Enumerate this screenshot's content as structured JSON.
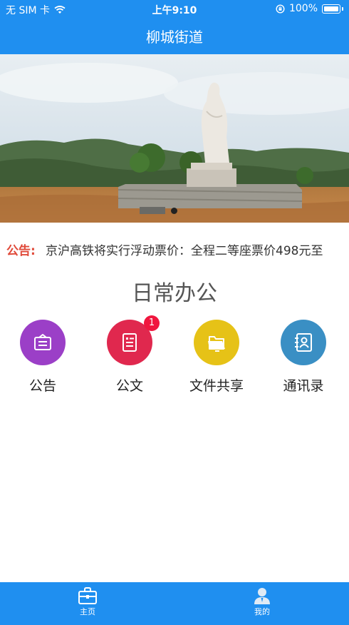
{
  "status": {
    "carrier": "无 SIM 卡",
    "time": "上午9:10",
    "battery": "100%"
  },
  "header": {
    "title": "柳城街道"
  },
  "banner": {
    "image": "statue-landscape",
    "pages": 1,
    "active_page": 1
  },
  "notice": {
    "label": "公告:",
    "text": "京沪高铁将实行浮动票价：全程二等座票价498元至"
  },
  "section": {
    "title": "日常办公"
  },
  "grid": {
    "items": [
      {
        "label": "公告",
        "icon": "announcement-icon",
        "color": "#9b3fc7"
      },
      {
        "label": "公文",
        "icon": "document-icon",
        "color": "#e0284e",
        "badge": "1"
      },
      {
        "label": "文件共享",
        "icon": "folder-share-icon",
        "color": "#e6c217"
      },
      {
        "label": "通讯录",
        "icon": "contacts-icon",
        "color": "#3a8fc4"
      }
    ]
  },
  "tabbar": {
    "tabs": [
      {
        "label": "主页",
        "icon": "briefcase-icon",
        "active": true
      },
      {
        "label": "我的",
        "icon": "user-icon",
        "active": false
      }
    ]
  },
  "colors": {
    "brand": "#1f8ff0",
    "notice_label": "#e04a3a",
    "badge": "#f0163e"
  }
}
